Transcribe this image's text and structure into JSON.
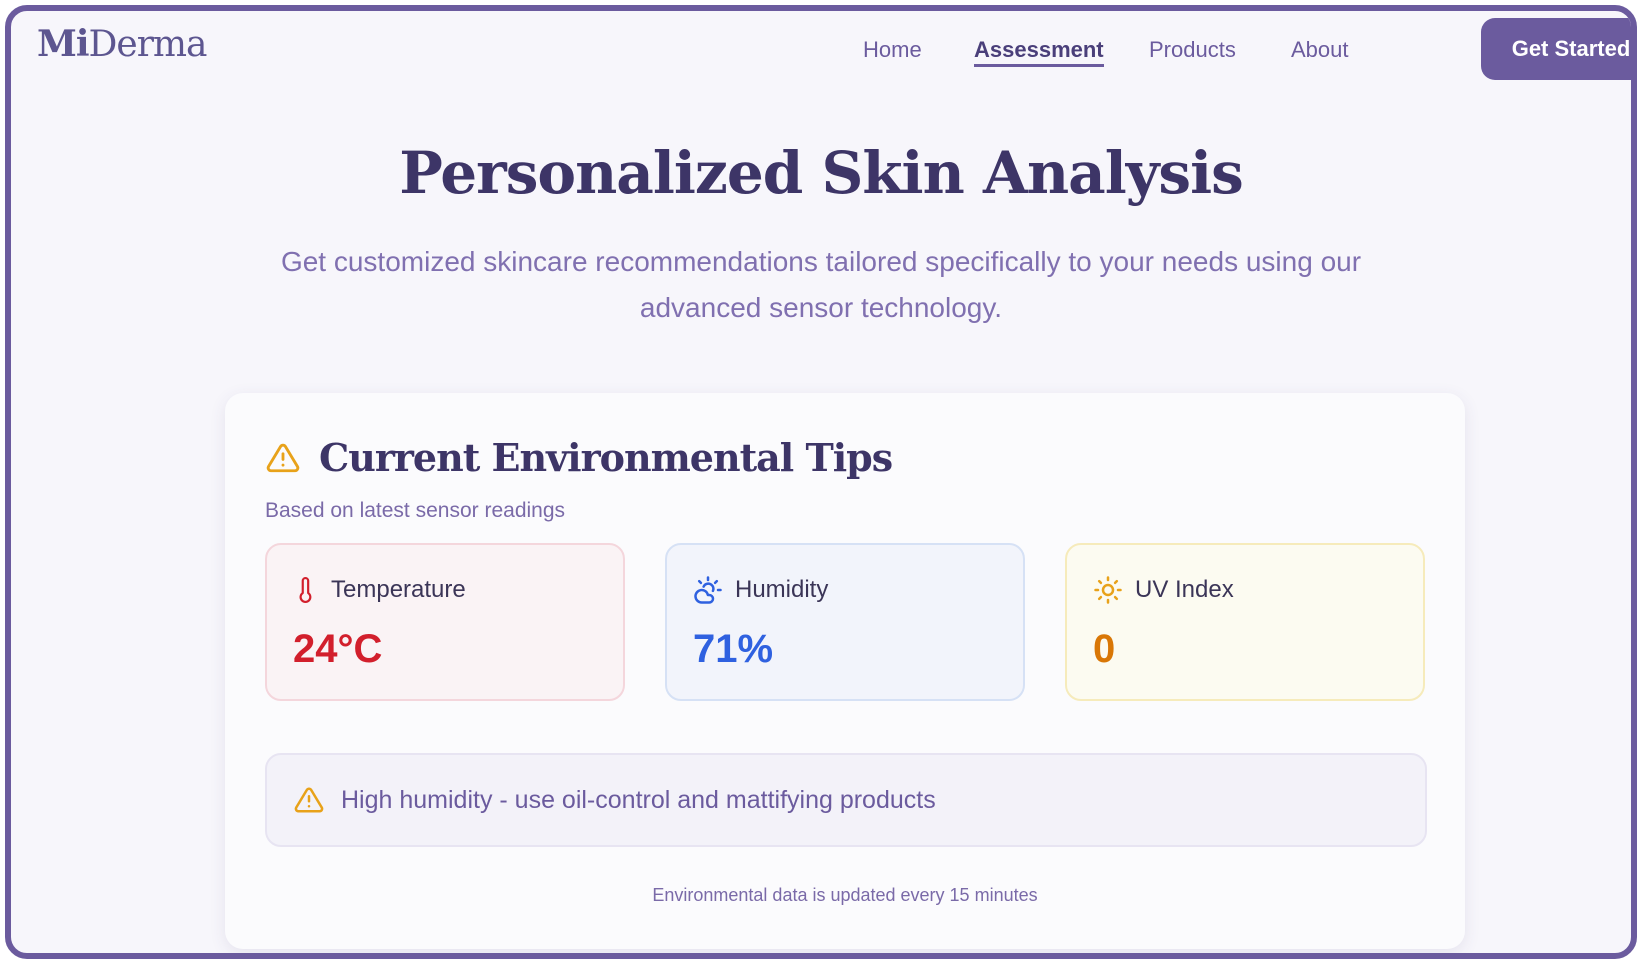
{
  "header": {
    "logo_prefix": "Mi",
    "logo_suffix": "Derma",
    "nav": [
      {
        "label": "Home"
      },
      {
        "label": "Assessment"
      },
      {
        "label": "Products"
      },
      {
        "label": "About"
      }
    ],
    "cta_label": "Get Started"
  },
  "hero": {
    "title": "Personalized Skin Analysis",
    "subtitle": "Get customized skincare recommendations tailored specifically to your needs using our advanced sensor technology."
  },
  "env_card": {
    "title": "Current Environmental Tips",
    "subtitle": "Based on latest sensor readings",
    "metrics": [
      {
        "label": "Temperature",
        "value": "24°C",
        "icon": "thermometer-icon"
      },
      {
        "label": "Humidity",
        "value": "71%",
        "icon": "cloud-sun-icon"
      },
      {
        "label": "UV Index",
        "value": "0",
        "icon": "sun-icon"
      }
    ],
    "tip": "High humidity - use oil-control and mattifying products",
    "footnote": "Environmental data is updated every 15 minutes",
    "colors": {
      "warning": "#e8a21a",
      "temperature": "#d21f2c",
      "humidity": "#2f61e0",
      "uv": "#d97706",
      "brand": "#6b5b9e"
    }
  }
}
